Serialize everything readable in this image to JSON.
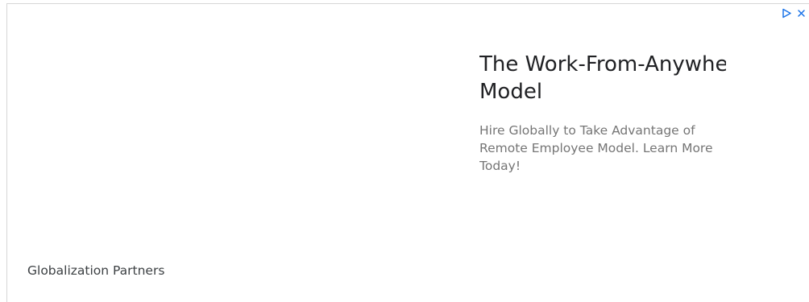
{
  "ad": {
    "headline_line1": "The Work-From-Anywhere",
    "headline_line2": "Model",
    "description_line1": "Hire Globally to Take Advantage of",
    "description_line2": "Remote Employee Model. Learn More",
    "description_line3": "Today!",
    "advertiser": "Globalization Partners",
    "icons": {
      "adchoices": "adchoices-triangle-icon",
      "close": "close-x-icon"
    },
    "accent_color": "#1a73e8",
    "headline_color": "#202124",
    "description_color": "#757575"
  }
}
